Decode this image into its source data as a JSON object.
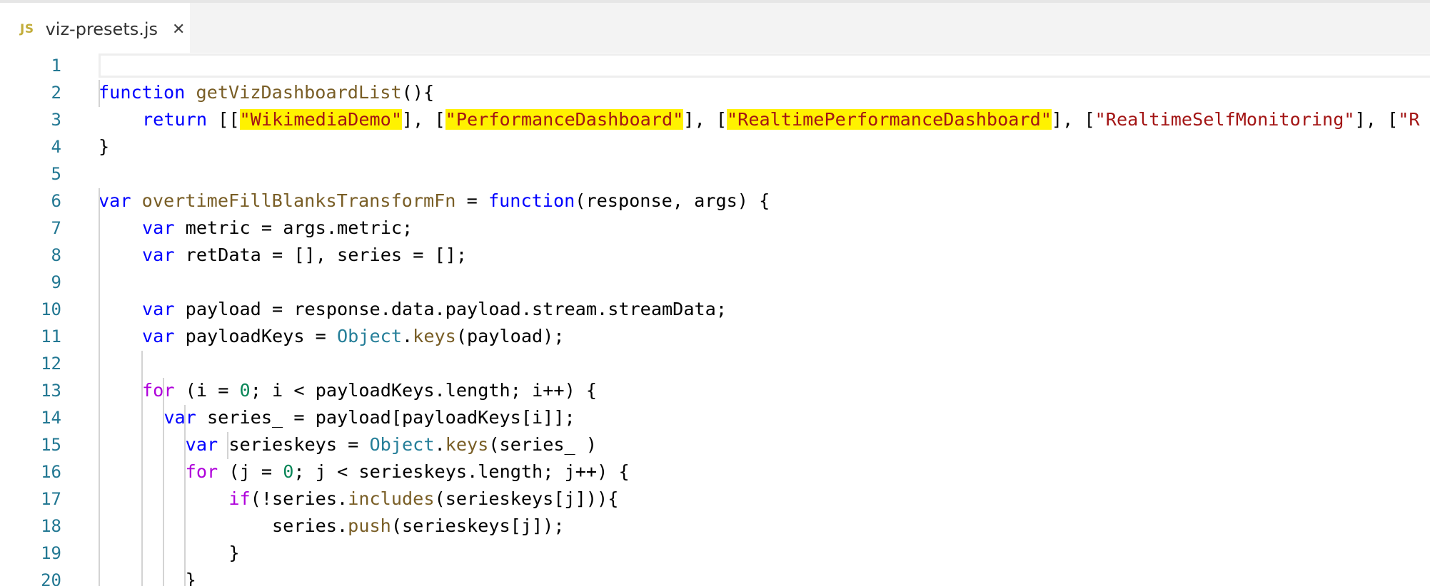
{
  "tab": {
    "lang_badge": "JS",
    "file_name": "viz-presets.js",
    "close_glyph": "✕",
    "icon": "javascript-file-icon"
  },
  "lines": [
    {
      "n": "1",
      "text": ""
    },
    {
      "n": "2",
      "text": "function getVizDashboardList(){"
    },
    {
      "n": "3",
      "text": "    return [[\"WikimediaDemo\"], [\"PerformanceDashboard\"], [\"RealtimePerformanceDashboard\"], [\"RealtimeSelfMonitoring\"], [\"R"
    },
    {
      "n": "4",
      "text": "}"
    },
    {
      "n": "5",
      "text": ""
    },
    {
      "n": "6",
      "text": "var overtimeFillBlanksTransformFn = function(response, args) {"
    },
    {
      "n": "7",
      "text": "    var metric = args.metric;"
    },
    {
      "n": "8",
      "text": "    var retData = [], series = [];"
    },
    {
      "n": "9",
      "text": ""
    },
    {
      "n": "10",
      "text": "    var payload = response.data.payload.stream.streamData;"
    },
    {
      "n": "11",
      "text": "    var payloadKeys = Object.keys(payload);"
    },
    {
      "n": "12",
      "text": ""
    },
    {
      "n": "13",
      "text": "    for (i = 0; i < payloadKeys.length; i++) {"
    },
    {
      "n": "14",
      "text": "      var series_ = payload[payloadKeys[i]];"
    },
    {
      "n": "15",
      "text": "        var serieskeys = Object.keys(series_ )"
    },
    {
      "n": "16",
      "text": "        for (j = 0; j < serieskeys.length; j++) {"
    },
    {
      "n": "17",
      "text": "            if(!series.includes(serieskeys[j])){"
    },
    {
      "n": "18",
      "text": "                series.push(serieskeys[j]);"
    },
    {
      "n": "19",
      "text": "            }"
    },
    {
      "n": "20",
      "text": "        }"
    }
  ],
  "highlighted_strings": [
    "WikimediaDemo",
    "PerformanceDashboard",
    "RealtimePerformanceDashboard"
  ],
  "colors": {
    "keyword": "#0000ff",
    "control": "#af00db",
    "function": "#795e26",
    "string": "#a31515",
    "number": "#098658",
    "class": "#267f99",
    "line_number": "#237893",
    "highlight": "#fff200"
  }
}
